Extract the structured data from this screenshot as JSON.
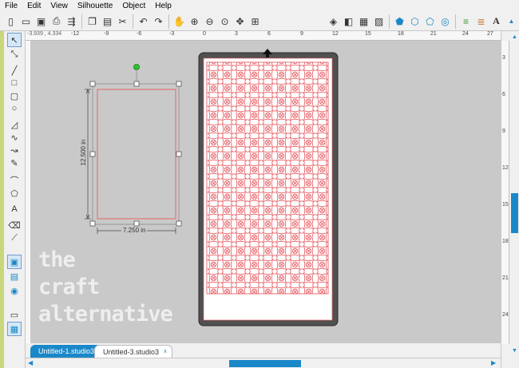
{
  "menu": {
    "items": [
      "File",
      "Edit",
      "View",
      "Silhouette",
      "Object",
      "Help"
    ]
  },
  "toolbar": {
    "left_icons": [
      "new-file-icon",
      "open-icon",
      "save-icon",
      "print-icon",
      "send-icon",
      "copy-icon",
      "paste-icon",
      "cut-icon",
      "undo-icon",
      "redo-icon",
      "pan-icon",
      "zoom-in-icon",
      "zoom-out-icon",
      "zoom-select-icon",
      "zoom-drag-icon",
      "fit-icon"
    ],
    "right_icons": [
      "fill-icon",
      "line-style-icon",
      "grid-icon",
      "transform-icon",
      "replicate-icon",
      "modify-icon",
      "offset-icon",
      "trace-icon",
      "align-icon",
      "text-style-icon",
      "text-icon"
    ]
  },
  "ruler": {
    "readout": "-3.939 , 4.334",
    "top_labels": [
      "-12",
      "-9",
      "-6",
      "-3",
      "0",
      "3",
      "6",
      "9",
      "12",
      "15",
      "18",
      "21",
      "24",
      "27"
    ],
    "right_labels": [
      "3",
      "6",
      "9",
      "12",
      "15",
      "18",
      "21",
      "24"
    ]
  },
  "selection": {
    "height_label": "12.500 in",
    "width_label": "7.250 in"
  },
  "tabs": [
    {
      "label": "Untitled-1.studio3",
      "active": true
    },
    {
      "label": "Untitled-3.studio3",
      "active": false
    }
  ],
  "watermark": {
    "line1": "the",
    "line2": "craft",
    "line3": "alternative"
  },
  "colors": {
    "accent": "#1a88c8",
    "cut_line": "#e8646a",
    "canvas": "#c9c9c9"
  }
}
